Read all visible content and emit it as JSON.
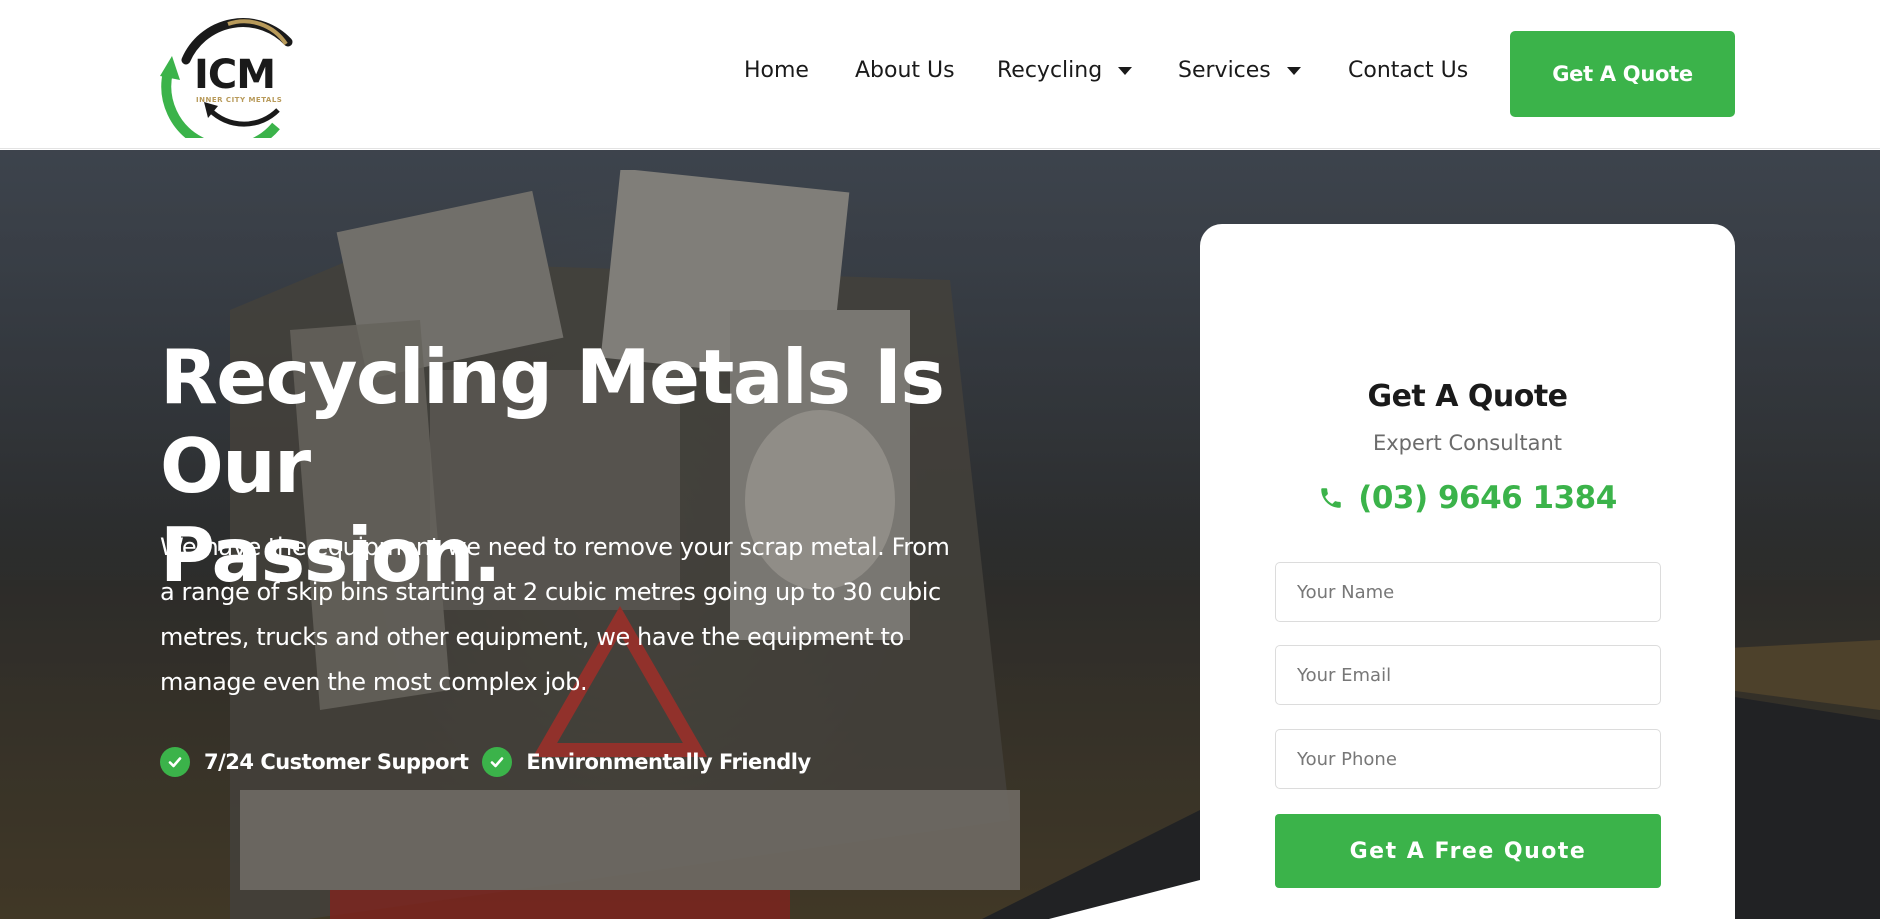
{
  "brand": {
    "logo_text": "ICM",
    "logo_subtext": "INNER CITY METALS",
    "accent_color": "#3bb34a",
    "gold_color": "#b89a5a"
  },
  "nav": {
    "items": [
      {
        "label": "Home"
      },
      {
        "label": "About Us"
      },
      {
        "label": "Recycling",
        "has_dropdown": true
      },
      {
        "label": "Services",
        "has_dropdown": true
      },
      {
        "label": "Contact Us"
      }
    ],
    "cta_label": "Get A Quote"
  },
  "hero": {
    "headline_line1": "Recycling Metals Is Our",
    "headline_line2": "Passion.",
    "lead": "We have the equipment we need to remove your scrap metal. From a range of skip bins starting at 2 cubic metres going up to 30 cubic metres, trucks and other equipment, we have the equipment to manage even the most complex job.",
    "features": [
      {
        "icon": "check-circle-icon",
        "label": "7/24 Customer Support"
      },
      {
        "icon": "check-circle-icon",
        "label": "Environmentally Friendly"
      }
    ]
  },
  "quote_form": {
    "title": "Get A Quote",
    "subtitle": "Expert Consultant",
    "phone_icon": "phone-icon",
    "phone": "(03) 9646 1384",
    "name_placeholder": "Your Name",
    "email_placeholder": "Your Email",
    "phone_placeholder": "Your Phone",
    "submit_label": "Get A Free Quote"
  }
}
